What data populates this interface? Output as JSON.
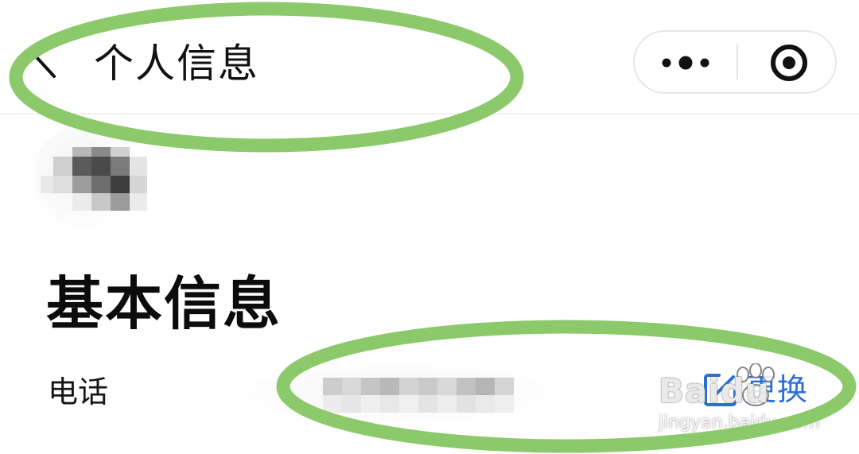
{
  "header": {
    "title": "个人信息",
    "back_icon": "chevron-left-icon",
    "capsule": {
      "more_icon": "more-dots-icon",
      "close_icon": "target-circle-icon"
    }
  },
  "profile": {
    "avatar_icon": "pixelated-avatar"
  },
  "section": {
    "title": "基本信息",
    "phone_label": "电话",
    "phone_value_state": "pixelated",
    "change_label": "更换",
    "change_icon": "edit-icon"
  },
  "watermark": {
    "brand": "Baidu",
    "url": "jingyan.baidu.com"
  },
  "colors": {
    "accent_link": "#2a6fd6",
    "annotation_ellipse": "#8cc96a",
    "divider": "#f1f1f1"
  }
}
